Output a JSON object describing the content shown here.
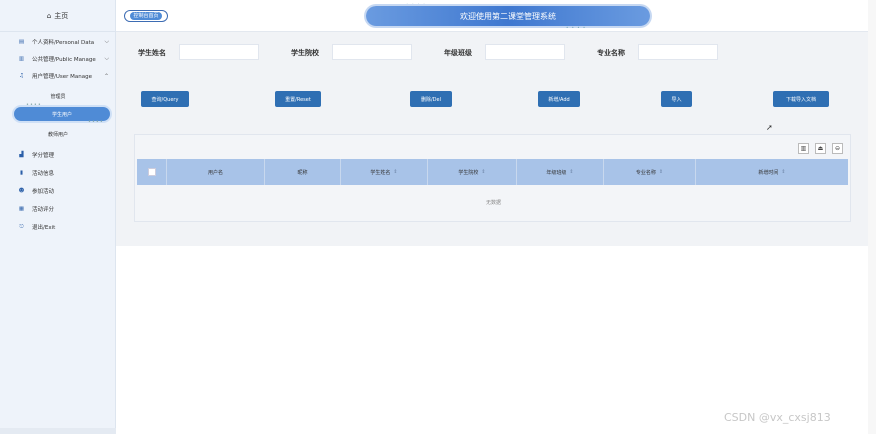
{
  "sidebar": {
    "title": "主页",
    "menu": [
      {
        "label": "个人资料/Personal Data",
        "arrow": "⌵"
      },
      {
        "label": "公共管理/Public Manage",
        "arrow": "⌵"
      },
      {
        "label": "用户管理/User Manage",
        "arrow": "⌃"
      }
    ],
    "sub_items": [
      "管理员",
      "学生用户",
      "教师用户"
    ],
    "active_sub": "学生用户",
    "bottom_menu": [
      "学分管理",
      "活动信息",
      "参加活动",
      "活动评分",
      "退出/Exit"
    ]
  },
  "header": {
    "home_tag": "控制台首页",
    "banner": "欢迎使用第二课堂管理系统"
  },
  "search": {
    "fields": [
      {
        "label": "学生姓名",
        "value": ""
      },
      {
        "label": "学生院校",
        "value": ""
      },
      {
        "label": "年级班级",
        "value": ""
      },
      {
        "label": "专业名称",
        "value": ""
      }
    ]
  },
  "actions": {
    "query": "查询/Query",
    "reset": "重置/Reset",
    "delete": "删除/Del",
    "add": "新增/Add",
    "import": "导入",
    "download": "下载导入文档"
  },
  "table": {
    "columns": [
      "用户名",
      "昵称",
      "学生姓名",
      "学生院校",
      "年级班级",
      "专业名称",
      "新增时间"
    ],
    "sortable": [
      false,
      false,
      true,
      true,
      true,
      true,
      true
    ],
    "empty_text": "无数据"
  },
  "watermark": "CSDN @vx_cxsj813",
  "colors": {
    "primary": "#2f6fb3",
    "header_row": "#a8c3e8",
    "accent": "#4f8bd6"
  }
}
